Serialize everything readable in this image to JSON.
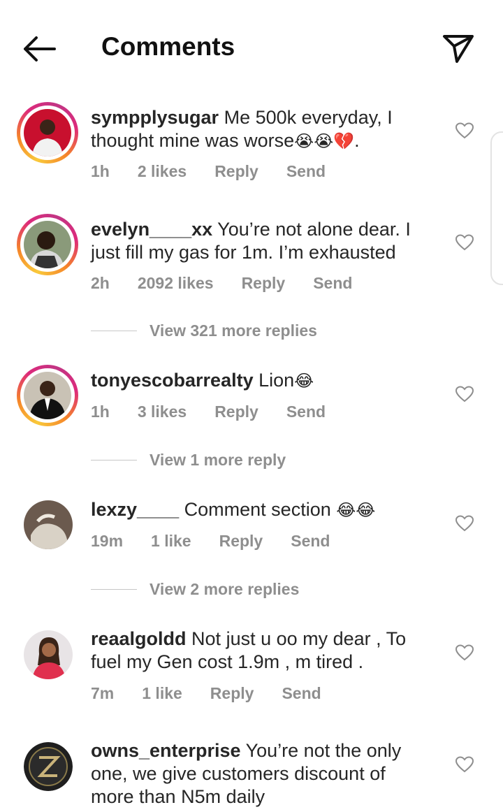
{
  "header": {
    "title": "Comments"
  },
  "comments": [
    {
      "username": "sympplysugar",
      "text": "Me 500k everyday, I thought mine was worse",
      "emoji": "😭😭💔",
      "tail": ".",
      "time": "1h",
      "likes": "2 likes",
      "reply": "Reply",
      "send": "Send",
      "story": true
    },
    {
      "username": "evelyn____xx",
      "text": "You’re not alone dear. I just fill my gas for 1m. I’m exhausted",
      "time": "2h",
      "likes": "2092 likes",
      "reply": "Reply",
      "send": "Send",
      "story": true,
      "view_replies": "View 321 more replies"
    },
    {
      "username": "tonyescobarrealty",
      "text": "Lion",
      "emoji": "😂",
      "time": "1h",
      "likes": "3 likes",
      "reply": "Reply",
      "send": "Send",
      "story": true,
      "view_replies": "View 1 more reply"
    },
    {
      "username": "lexzy____",
      "text": "Comment section ",
      "emoji": "😂😂",
      "time": "19m",
      "likes": "1 like",
      "reply": "Reply",
      "send": "Send",
      "story": false,
      "view_replies": "View 2 more replies"
    },
    {
      "username": "reaalgoldd",
      "text": "Not just u oo my dear , To fuel my Gen cost 1.9m , m tired .",
      "time": "7m",
      "likes": "1 like",
      "reply": "Reply",
      "send": "Send",
      "story": false
    },
    {
      "username": "owns_enterprise",
      "text": "You’re not the only one, we give customers discount of more than N5m daily",
      "story": false
    }
  ]
}
